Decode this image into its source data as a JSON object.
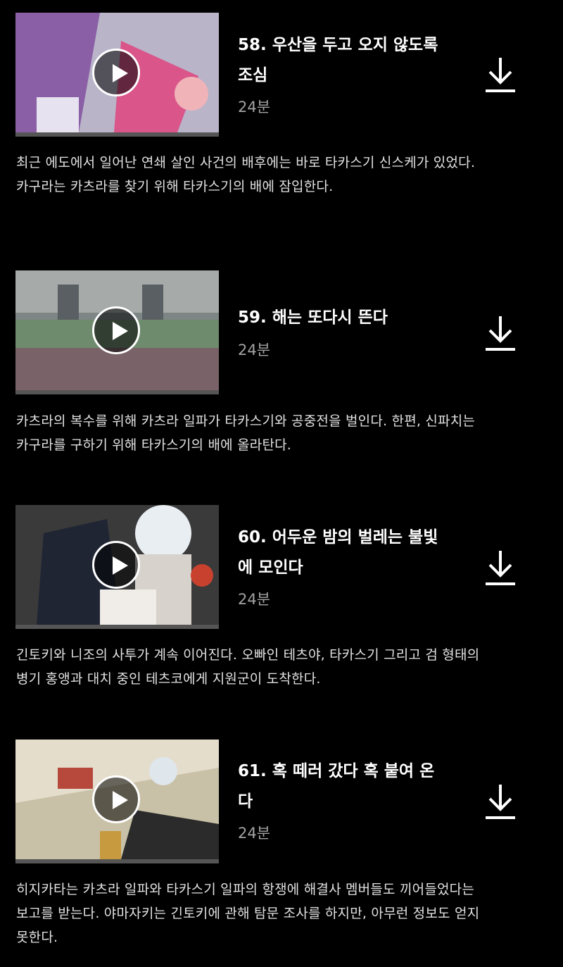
{
  "episodes": [
    {
      "title": "58. 우산을 두고 오지 않도록 조심",
      "duration": "24분",
      "synopsis": "최근 에도에서 일어난 연쇄 살인 사건의 배후에는 바로 타카스기 신스케가 있었다. 카구라는 카츠라를 찾기 위해 타카스기의 배에 잠입한다."
    },
    {
      "title": "59. 해는 또다시 뜬다",
      "duration": "24분",
      "synopsis": "카츠라의 복수를 위해 카츠라 일파가 타카스기와 공중전을 벌인다. 한편, 신파치는 카구라를 구하기 위해 타카스기의 배에 올라탄다."
    },
    {
      "title": "60. 어두운 밤의 벌레는 불빛에 모인다",
      "duration": "24분",
      "synopsis": "긴토키와 니조의 사투가 계속 이어진다. 오빠인 테츠야, 타카스기 그리고 검 형태의 병기 홍앵과 대치 중인 테츠코에게 지원군이 도착한다."
    },
    {
      "title": "61. 혹 떼러 갔다 혹 붙여 온다",
      "duration": "24분",
      "synopsis": "히지카타는 카츠라 일파와 타카스기 일파의 항쟁에 해결사 멤버들도 끼어들었다는 보고를 받는다. 야마자키는 긴토키에 관해 탐문 조사를 하지만, 아무런 정보도 얻지 못한다."
    }
  ]
}
